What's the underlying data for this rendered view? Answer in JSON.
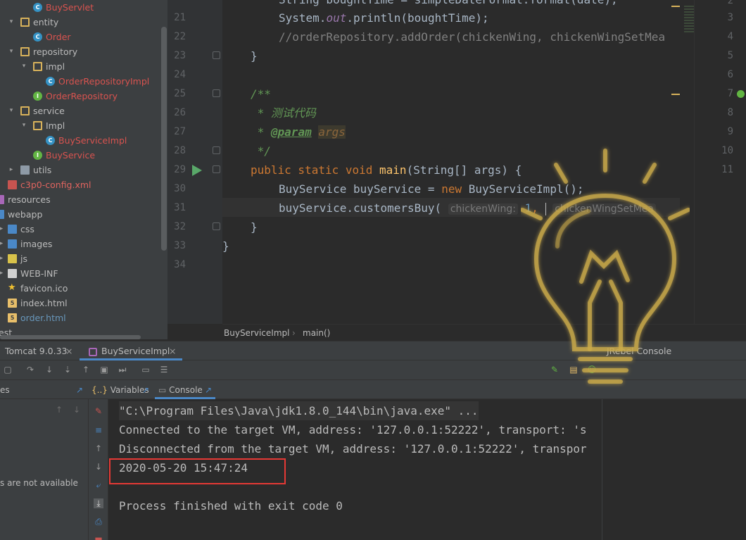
{
  "project_tree": {
    "items": [
      {
        "label": "BuyServlet",
        "icon": "class-icon",
        "arrow": ""
      },
      {
        "label": "entity",
        "icon": "package-icon",
        "arrow": "▾"
      },
      {
        "label": "Order",
        "icon": "class-icon",
        "arrow": ""
      },
      {
        "label": "repository",
        "icon": "package-icon",
        "arrow": "▾"
      },
      {
        "label": "impl",
        "icon": "package-icon",
        "arrow": "▾"
      },
      {
        "label": "OrderRepositoryImpl",
        "icon": "class-icon",
        "arrow": ""
      },
      {
        "label": "OrderRepository",
        "icon": "interface-icon",
        "arrow": ""
      },
      {
        "label": "service",
        "icon": "package-icon",
        "arrow": "▾"
      },
      {
        "label": "Impl",
        "icon": "package-icon",
        "arrow": "▾"
      },
      {
        "label": "BuyServiceImpl",
        "icon": "class-icon",
        "arrow": ""
      },
      {
        "label": "BuyService",
        "icon": "interface-icon",
        "arrow": ""
      },
      {
        "label": "utils",
        "icon": "folder-icon",
        "arrow": "▸"
      },
      {
        "label": "c3p0-config.xml",
        "icon": "xml-file-icon",
        "arrow": ""
      },
      {
        "label": "resources",
        "icon": "resources-folder-icon",
        "arrow": ""
      },
      {
        "label": "webapp",
        "icon": "web-folder-icon",
        "arrow": ""
      },
      {
        "label": "css",
        "icon": "folder-icon",
        "arrow": ""
      },
      {
        "label": "images",
        "icon": "folder-icon",
        "arrow": ""
      },
      {
        "label": "js",
        "icon": "folder-icon",
        "arrow": ""
      },
      {
        "label": "WEB-INF",
        "icon": "folder-icon",
        "arrow": ""
      },
      {
        "label": "favicon.ico",
        "icon": "star-icon",
        "arrow": ""
      },
      {
        "label": "index.html",
        "icon": "html-file-icon",
        "arrow": ""
      },
      {
        "label": "order.html",
        "icon": "html-file-icon",
        "arrow": ""
      },
      {
        "label": "est",
        "icon": "",
        "arrow": ""
      }
    ]
  },
  "editor": {
    "line_numbers": [
      "21",
      "22",
      "23",
      "24",
      "25",
      "26",
      "27",
      "28",
      "29",
      "30",
      "31",
      "32",
      "33",
      "34"
    ],
    "code": {
      "l20_a": "String boughtTime = simpleDateFormat.format(date);",
      "l21_a": "System.",
      "l21_b": "out",
      "l21_c": ".println(boughtTime);",
      "l22": "//orderRepository.addOrder(chickenWing, chickenWingSetMea",
      "l23": "}",
      "l25": "/**",
      "l26": " * 测试代码",
      "l27_star": " * ",
      "l27_tag": "@param",
      "l27_param": "args",
      "l28": " */",
      "l29_kw": "public static void ",
      "l29_fn": "main",
      "l29_rest": "(String[] args) {",
      "l30_a": "BuyService buyService = ",
      "l30_kw": "new ",
      "l30_b": "BuyServiceImpl();",
      "l31_a": "buyService.customersBuy(",
      "l31_hint1": "chickenWing:",
      "l31_num": "1",
      "l31_comma": ",",
      "l31_hint2": "chickenWingSetMea",
      "l32": "}",
      "l33": "}"
    },
    "right_pane_line_numbers": [
      "2",
      "3",
      "4",
      "5",
      "6",
      "7",
      "8",
      "9",
      "10",
      "11"
    ]
  },
  "breadcrumb": {
    "class_name": "BuyServiceImpl",
    "separator": "›",
    "method": "main()"
  },
  "debug": {
    "tabs": {
      "tomcat": "Tomcat 9.0.33",
      "buyserviceimpl": "BuyServiceImpl",
      "close": "×",
      "jrebel": "JRebel Console"
    },
    "sub_tabs": {
      "frames": "es",
      "variables": "Variables",
      "console": "Console"
    },
    "frames_message": "s are not available",
    "console_lines": {
      "cmd": "\"C:\\Program Files\\Java\\jdk1.8.0_144\\bin\\java.exe\" ...",
      "connected": "Connected to the target VM, address: '127.0.0.1:52222', transport: 's",
      "disconnected": "Disconnected from the target VM, address: '127.0.0.1:52222', transpor",
      "timestamp": "2020-05-20 15:47:24",
      "finished": "Process finished with exit code 0"
    }
  },
  "colors": {
    "highlight_box": "#e53935",
    "run_gutter": "#59a869",
    "accent": "#4a88c7"
  }
}
